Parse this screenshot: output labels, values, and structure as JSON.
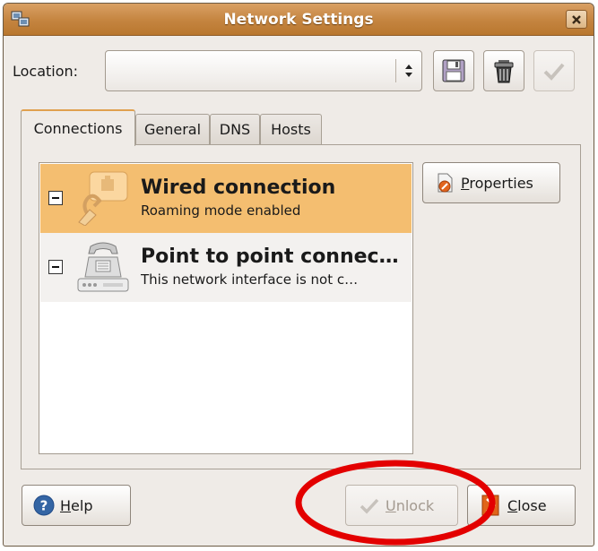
{
  "window": {
    "title": "Network Settings"
  },
  "location": {
    "label": "Location:",
    "value": ""
  },
  "tabs": [
    {
      "label": "Connections",
      "active": true
    },
    {
      "label": "General",
      "active": false
    },
    {
      "label": "DNS",
      "active": false
    },
    {
      "label": "Hosts",
      "active": false
    }
  ],
  "connections": [
    {
      "title": "Wired connection",
      "subtitle": "Roaming mode enabled",
      "icon": "wired-network-icon",
      "selected": true
    },
    {
      "title": "Point to point connec…",
      "subtitle": "This network interface is not c…",
      "icon": "telephone-modem-icon",
      "selected": false
    }
  ],
  "buttons": {
    "properties": "Properties",
    "help": "Help",
    "unlock": "Unlock",
    "close": "Close"
  },
  "colors": {
    "titlebar": "#c4843f",
    "selection": "#f4be70",
    "annotation": "#e30000"
  }
}
